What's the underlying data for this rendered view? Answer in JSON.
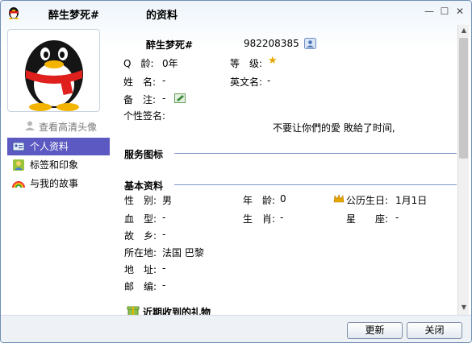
{
  "window": {
    "title_name": "醉生梦死#",
    "title_suffix": "的资料",
    "min_glyph": "—",
    "max_glyph": "☐",
    "close_glyph": "✕"
  },
  "left": {
    "view_hd": "查看高清头像",
    "nav": [
      {
        "label": "个人资料",
        "icon": "id-card-icon",
        "active": true
      },
      {
        "label": "标签和印象",
        "icon": "tag-portrait-icon",
        "active": false
      },
      {
        "label": "与我的故事",
        "icon": "rainbow-icon",
        "active": false
      }
    ]
  },
  "profile": {
    "nickname": "醉生梦死#",
    "qq_number": "982208385",
    "age_label": "Q　龄:",
    "age_value": "0年",
    "level_label": "等　级:",
    "name_label": "姓　名:",
    "name_value": "-",
    "english_name_label": "英文名:",
    "english_name_value": "-",
    "remark_label": "备　注:",
    "remark_value": "-",
    "signature_label": "个性签名:",
    "signature_value": "不要让你們的愛  敗給了时间,"
  },
  "sections": {
    "service_icons": "服务图标",
    "basic_info": "基本资料",
    "recent_gifts": "近期收到的礼物"
  },
  "basic": {
    "gender_label": "性　别:",
    "gender_value": "男",
    "age_label": "年　龄:",
    "age_value": "0",
    "birthday_label": "公历生日:",
    "birthday_value": "1月1日",
    "blood_label": "血　型:",
    "blood_value": "-",
    "zodiac_label": "生　肖:",
    "zodiac_value": "-",
    "constellation_label": "星　　座:",
    "constellation_value": "-",
    "hometown_label": "故　乡:",
    "hometown_value": "-",
    "location_label": "所在地:",
    "location_value": "法国 巴黎",
    "address_label": "地　址:",
    "address_value": "-",
    "postcode_label": "邮　编:",
    "postcode_value": "-"
  },
  "buttons": {
    "refresh": "更新",
    "close": "关闭"
  },
  "colors": {
    "nav_active_bg": "#5c5ac2",
    "section_line": "#7d97c7"
  }
}
